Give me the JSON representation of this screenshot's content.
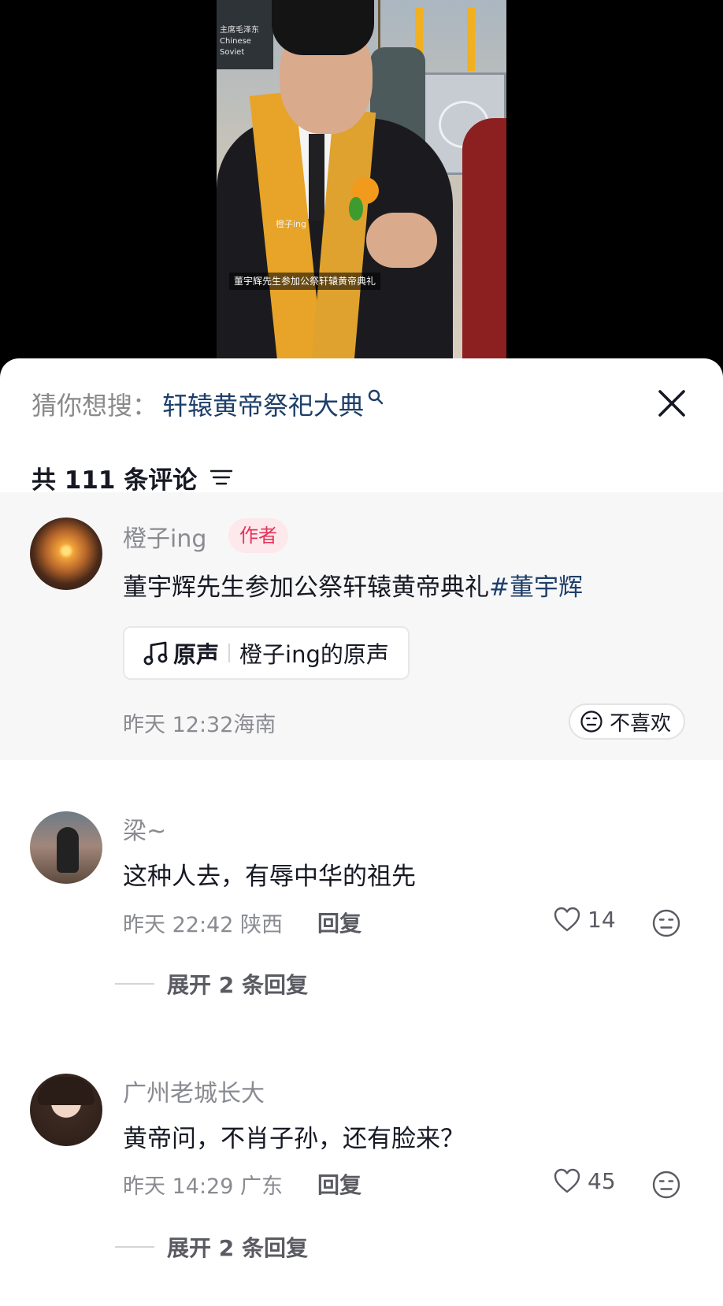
{
  "video": {
    "caption": "董宇辉先生参加公祭轩辕黄帝典礼",
    "watermark": "橙子ing",
    "sign_text": "主席毛泽东 Chinese Soviet"
  },
  "search_suggestion": {
    "prefix": "猜你想搜：",
    "query": "轩辕黄帝祭祀大典"
  },
  "comments_header": {
    "count_text": "共 111 条评论"
  },
  "author_comment": {
    "name": "橙子ing",
    "badge": "作者",
    "text": "董宇辉先生参加公祭轩辕黄帝典礼",
    "hashtag": "#董宇辉",
    "sound_label": "原声",
    "sound_title": "橙子ing的原声",
    "meta": "昨天 12:32海南",
    "dislike_label": "不喜欢"
  },
  "comments": [
    {
      "name": "梁~",
      "text": "这种人去，有辱中华的祖先",
      "meta": "昨天 22:42 陕西",
      "reply_label": "回复",
      "likes": "14",
      "expand_label": "展开 2 条回复"
    },
    {
      "name": "广州老城长大",
      "text": "黄帝问，不肖子孙，还有脸来？",
      "meta": "昨天 14:29 广东",
      "reply_label": "回复",
      "likes": "45",
      "expand_label": "展开 2 条回复"
    }
  ],
  "icons": {
    "search": "search-icon",
    "close": "close-icon",
    "sort": "sort-icon",
    "music": "music-note-icon",
    "dislike": "neutral-face-icon",
    "like": "heart-icon",
    "emoji": "neutral-face-icon"
  },
  "colors": {
    "link_blue": "#1e3f6a",
    "author_badge_bg": "#fde8ec",
    "author_badge_text": "#e5335a",
    "muted": "#8a8b91",
    "text": "#161823"
  }
}
